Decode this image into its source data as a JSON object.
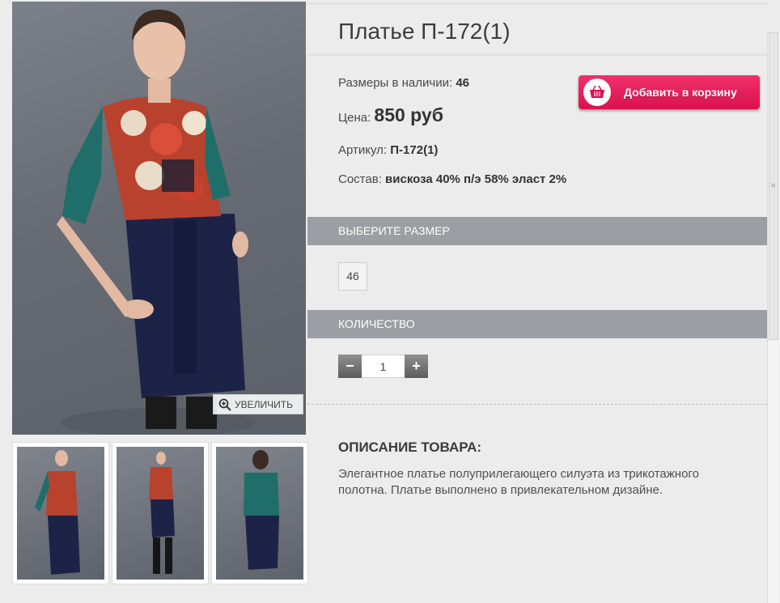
{
  "product": {
    "title": "Платье П-172(1)",
    "sizes_label": "Размеры в наличии: ",
    "sizes_value": "46",
    "price_label": "Цена: ",
    "price_value": "850 руб",
    "article_label": "Артикул: ",
    "article_value": "П-172(1)",
    "composition_label": "Состав: ",
    "composition_value": "вискоза 40% п/э 58% эласт 2%"
  },
  "cart_button": {
    "label": "Добавить в корзину",
    "icon": "basket-icon"
  },
  "gallery": {
    "zoom_label": "УВЕЛИЧИТЬ",
    "zoom_icon": "magnifier-plus-icon",
    "thumbnail_count": 3
  },
  "size_section": {
    "heading": "ВЫБЕРИТЕ РАЗМЕР",
    "options": [
      "46"
    ]
  },
  "quantity_section": {
    "heading": "КОЛИЧЕСТВО",
    "minus": "−",
    "plus": "+",
    "value": "1"
  },
  "description": {
    "heading": "ОПИСАНИЕ ТОВАРА:",
    "text": "Элегантное платье полуприлегающего силуэта из трикотажного полотна. Платье выполнено в привлекательном дизайне."
  },
  "colors": {
    "accent": "#e01858",
    "band": "#9b9ea2",
    "background": "#ececec"
  }
}
